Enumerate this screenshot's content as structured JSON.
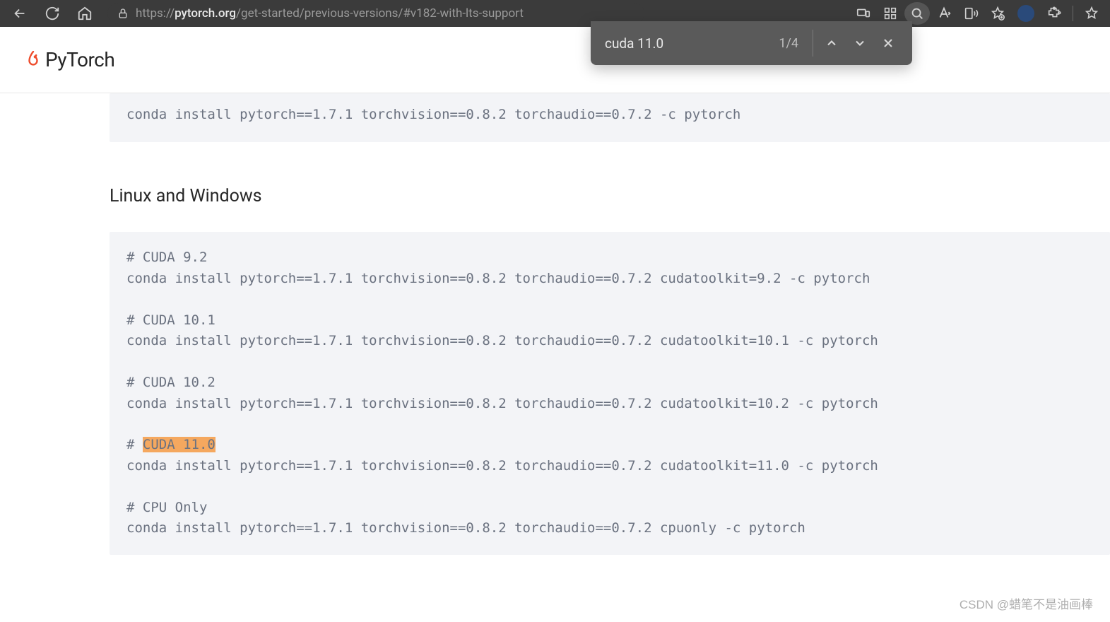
{
  "browser": {
    "url_prefix": "https://",
    "url_domain": "pytorch.org",
    "url_path": "/get-started/previous-versions/#v182-with-lts-support"
  },
  "find": {
    "query": "cuda 11.0",
    "count": "1/4"
  },
  "logo": {
    "text": "PyTorch"
  },
  "code": {
    "top_block": "conda install pytorch==1.7.1 torchvision==0.8.2 torchaudio==0.7.2 -c pytorch",
    "section_heading": "Linux and Windows",
    "lines": [
      "# CUDA 9.2",
      "conda install pytorch==1.7.1 torchvision==0.8.2 torchaudio==0.7.2 cudatoolkit=9.2 -c pytorch",
      "",
      "# CUDA 10.1",
      "conda install pytorch==1.7.1 torchvision==0.8.2 torchaudio==0.7.2 cudatoolkit=10.1 -c pytorch",
      "",
      "# CUDA 10.2",
      "conda install pytorch==1.7.1 torchvision==0.8.2 torchaudio==0.7.2 cudatoolkit=10.2 -c pytorch",
      ""
    ],
    "highlight_prefix": "# ",
    "highlight_text": "CUDA 11.0",
    "tail_lines": [
      "conda install pytorch==1.7.1 torchvision==0.8.2 torchaudio==0.7.2 cudatoolkit=11.0 -c pytorch",
      "",
      "# CPU Only",
      "conda install pytorch==1.7.1 torchvision==0.8.2 torchaudio==0.7.2 cpuonly -c pytorch"
    ]
  },
  "watermark": "CSDN @蜡笔不是油画棒"
}
